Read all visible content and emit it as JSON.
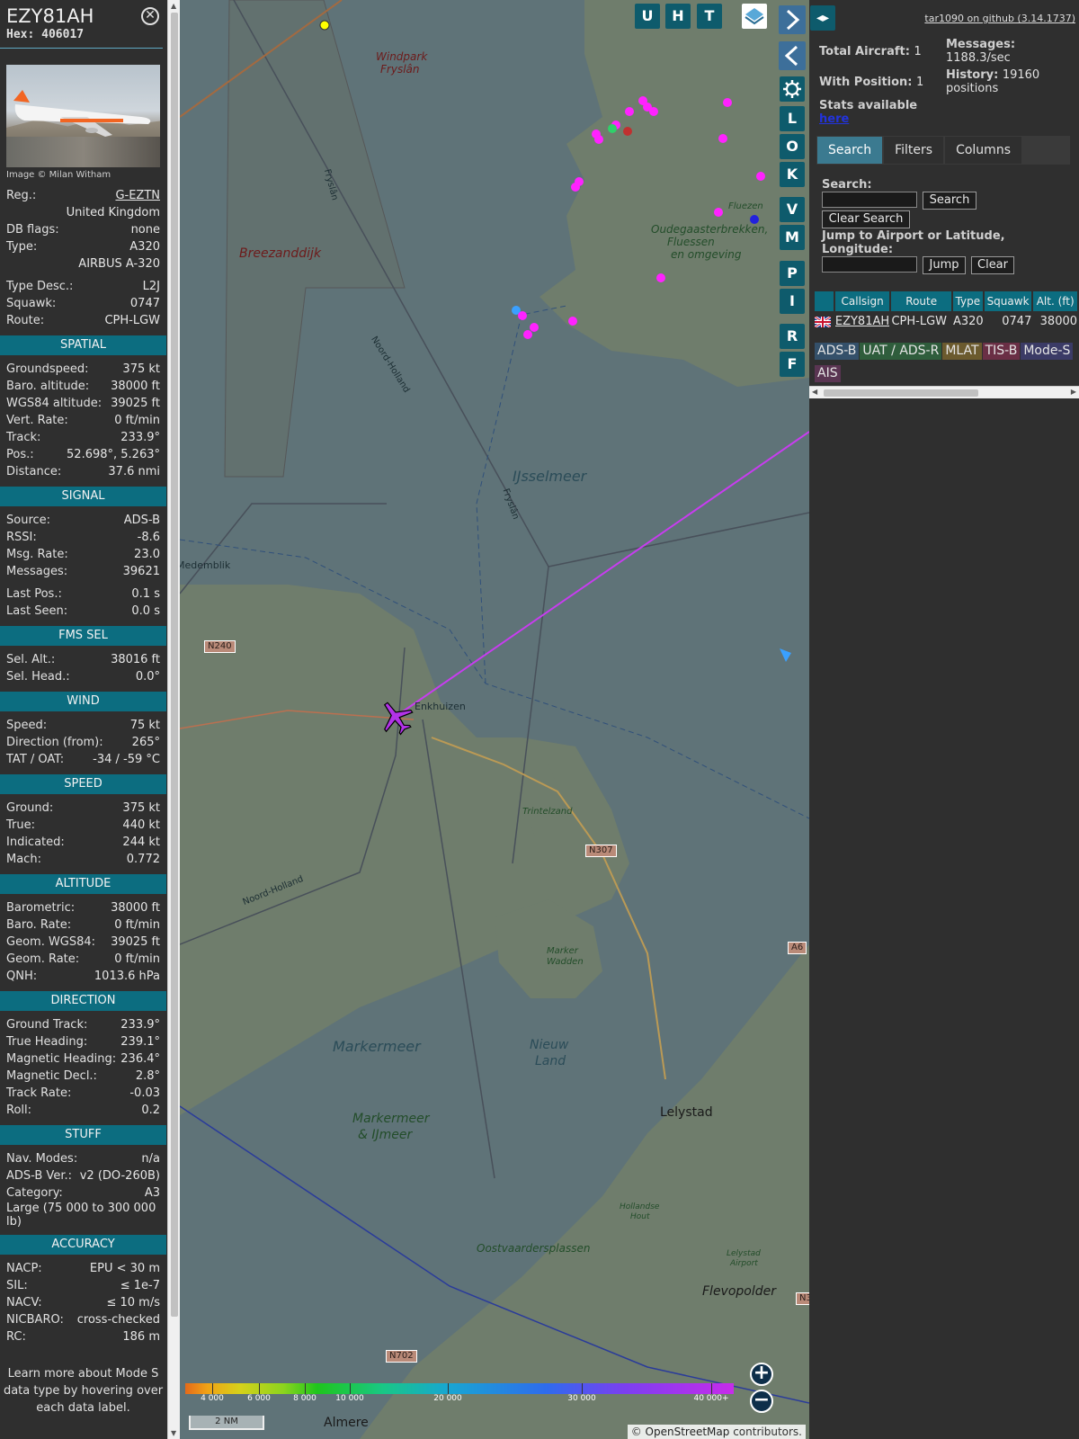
{
  "info": {
    "callsign": "EZY81AH",
    "hex_label": "Hex:",
    "hex": "406017",
    "photo_credit": "Image © Milan Witham",
    "reg_label": "Reg.:",
    "reg": "G-EZTN",
    "country": "United Kingdom",
    "dbflags_label": "DB flags:",
    "dbflags": "none",
    "type_label": "Type:",
    "type": "A320",
    "type_full": "AIRBUS A-320",
    "typedesc_label": "Type Desc.:",
    "typedesc": "L2J",
    "squawk_label": "Squawk:",
    "squawk": "0747",
    "route_label": "Route:",
    "route": "CPH-LGW",
    "sections": {
      "spatial": "SPATIAL",
      "signal": "SIGNAL",
      "fms": "FMS SEL",
      "wind": "WIND",
      "speed": "SPEED",
      "altitude": "ALTITUDE",
      "direction": "DIRECTION",
      "stuff": "STUFF",
      "accuracy": "ACCURACY"
    },
    "spatial": [
      {
        "k": "Groundspeed:",
        "v": "375 kt"
      },
      {
        "k": "Baro. altitude:",
        "v": "38000 ft"
      },
      {
        "k": "WGS84 altitude:",
        "v": "39025 ft"
      },
      {
        "k": "Vert. Rate:",
        "v": "0 ft/min"
      },
      {
        "k": "Track:",
        "v": "233.9°"
      },
      {
        "k": "Pos.:",
        "v": "52.698°, 5.263°"
      },
      {
        "k": "Distance:",
        "v": "37.6 nmi"
      }
    ],
    "signal": [
      {
        "k": "Source:",
        "v": "ADS-B"
      },
      {
        "k": "RSSI:",
        "v": "-8.6"
      },
      {
        "k": "Msg. Rate:",
        "v": "23.0"
      },
      {
        "k": "Messages:",
        "v": "39621"
      }
    ],
    "signal2": [
      {
        "k": "Last Pos.:",
        "v": "0.1 s"
      },
      {
        "k": "Last Seen:",
        "v": "0.0 s"
      }
    ],
    "fms": [
      {
        "k": "Sel. Alt.:",
        "v": "38016 ft"
      },
      {
        "k": "Sel. Head.:",
        "v": "0.0°"
      }
    ],
    "wind": [
      {
        "k": "Speed:",
        "v": "75 kt"
      },
      {
        "k": "Direction (from):",
        "v": "265°"
      },
      {
        "k": "TAT / OAT:",
        "v": "-34 / -59 °C"
      }
    ],
    "speed": [
      {
        "k": "Ground:",
        "v": "375 kt"
      },
      {
        "k": "True:",
        "v": "440 kt"
      },
      {
        "k": "Indicated:",
        "v": "244 kt"
      },
      {
        "k": "Mach:",
        "v": "0.772"
      }
    ],
    "altitude": [
      {
        "k": "Barometric:",
        "v": "38000 ft"
      },
      {
        "k": "Baro. Rate:",
        "v": "0 ft/min"
      },
      {
        "k": "Geom. WGS84:",
        "v": "39025 ft"
      },
      {
        "k": "Geom. Rate:",
        "v": "0 ft/min"
      },
      {
        "k": "QNH:",
        "v": "1013.6 hPa"
      }
    ],
    "direction": [
      {
        "k": "Ground Track:",
        "v": "233.9°"
      },
      {
        "k": "True Heading:",
        "v": "239.1°"
      },
      {
        "k": "Magnetic Heading:",
        "v": "236.4°"
      },
      {
        "k": "Magnetic Decl.:",
        "v": "2.8°"
      },
      {
        "k": "Track Rate:",
        "v": "-0.03"
      },
      {
        "k": "Roll:",
        "v": "0.2"
      }
    ],
    "stuff": [
      {
        "k": "Nav. Modes:",
        "v": "n/a"
      },
      {
        "k": "ADS-B Ver.:",
        "v": "v2 (DO-260B)"
      },
      {
        "k": "Category:",
        "v": "A3"
      }
    ],
    "category_desc": "Large (75 000 to 300 000 lb)",
    "accuracy": [
      {
        "k": "NACP:",
        "v": "EPU < 30 m"
      },
      {
        "k": "SIL:",
        "v": "≤ 1e-7"
      },
      {
        "k": "NACV:",
        "v": "≤ 10 m/s"
      },
      {
        "k": "NICBARO:",
        "v": "cross-checked"
      },
      {
        "k": "RC:",
        "v": "186 m"
      }
    ],
    "learn_more": "Learn more about Mode S data type by hovering over each data label."
  },
  "map": {
    "buttons_top": [
      "U",
      "H",
      "T"
    ],
    "buttons_side": [
      "L",
      "O",
      "K",
      "V",
      "M",
      "P",
      "I",
      "R",
      "F"
    ],
    "labels": {
      "windpark": "Windpark",
      "fryslan_wp": "Fryslân",
      "breezanddijk": "Breezanddijk",
      "fryslan1": "Fryslân",
      "noord_holland1": "Noord-Holland",
      "ijsselmeer": "IJsselmeer",
      "fryslan2": "Fryslân",
      "medemblik": "Medemblik",
      "enkhuizen": "Enkhuizen",
      "oudega1": "Oudegaasterbrekken,",
      "oudega2": "Fluessen",
      "oudega3": "en omgeving",
      "fluezen": "Fluezen",
      "trintelzand": "Trintelzand",
      "noord_holland2": "Noord-Holland",
      "marker_wadden1": "Marker",
      "marker_wadden2": "Wadden",
      "markermeer": "Markermeer",
      "nieuw": "Nieuw",
      "land": "Land",
      "markermeer_ij1": "Markermeer",
      "markermeer_ij2": "& IJmeer",
      "lelystad": "Lelystad",
      "hollandse1": "Hollandse",
      "hollandse2": "Hout",
      "oostvaarders": "Oostvaardersplassen",
      "lelystad_airport1": "Lelystad",
      "lelystad_airport2": "Airport",
      "flevopolder": "Flevopolder",
      "almere": "Almere",
      "n240": "N240",
      "n307": "N307",
      "a6": "A6",
      "n702": "N702",
      "n3": "N3"
    },
    "altitude_scale": [
      "4 000",
      "6 000",
      "8 000",
      "10 000",
      "20 000",
      "30 000",
      "40 000+"
    ],
    "nm_scale": "2 NM",
    "attribution_prefix": "©",
    "attribution_link": "OpenStreetMap",
    "attribution_suffix": "contributors.",
    "colors": {
      "water": "#5f7378",
      "land": "#6f7d6c",
      "track": "#c83cf0",
      "aircraft": "#b233e8"
    }
  },
  "sidebar": {
    "github": "tar1090 on github (3.14.1737)",
    "total_label": "Total Aircraft:",
    "total": "1",
    "messages_label": "Messages:",
    "messages": "1188.3/sec",
    "withpos_label": "With Position:",
    "withpos": "1",
    "history_label": "History:",
    "history_val": "19160",
    "history_unit": "positions",
    "stats_text": "Stats available",
    "stats_link": "here",
    "tabs": [
      "Search",
      "Filters",
      "Columns"
    ],
    "search_label": "Search:",
    "search_btn": "Search",
    "clear_search_btn": "Clear Search",
    "jump_label": "Jump to Airport or Latitude, Longitude:",
    "jump_btn": "Jump",
    "clear_btn": "Clear",
    "columns": [
      "Callsign",
      "Route",
      "Type",
      "Squawk",
      "Alt. (ft)"
    ],
    "rows": [
      {
        "callsign": "EZY81AH",
        "route": "CPH-LGW",
        "type": "A320",
        "squawk": "0747",
        "alt": "38000"
      }
    ],
    "badges": [
      {
        "label": "ADS-B",
        "color": "#34506a"
      },
      {
        "label": "UAT / ADS-R",
        "color": "#2f5d3c"
      },
      {
        "label": "MLAT",
        "color": "#6b5a2e"
      },
      {
        "label": "TIS-B",
        "color": "#6a2f45"
      },
      {
        "label": "Mode-S",
        "color": "#3b3b66"
      },
      {
        "label": "AIS",
        "color": "#5a3552"
      }
    ]
  }
}
